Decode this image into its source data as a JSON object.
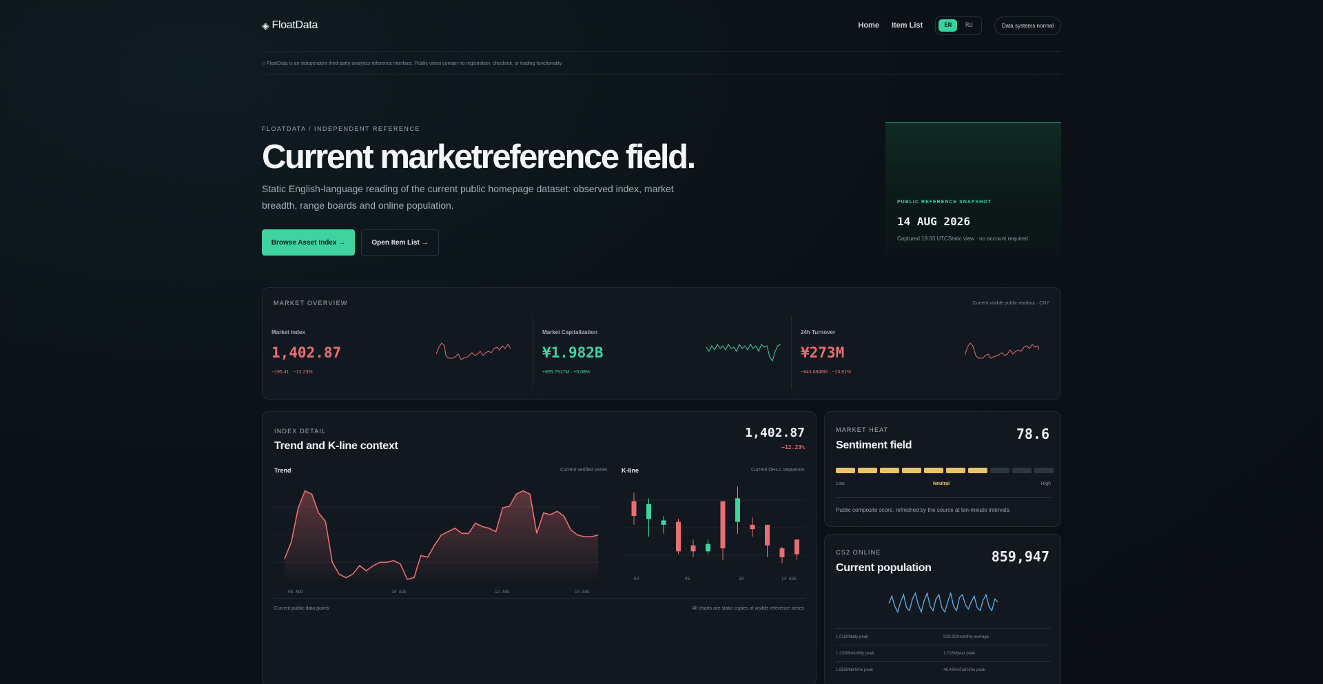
{
  "nav": {
    "brand_icon": "◈",
    "brand": "FloatData",
    "links": [
      "Home",
      "Item List"
    ],
    "lang": [
      "EN",
      "RU"
    ],
    "status": "Data systems normal"
  },
  "disclaimer": "◇ FloatData is an independent third-party analytics reference interface. Public views contain no registration, checkout, or trading functionality.",
  "hero": {
    "eyebrow": "FLOATDATA / INDEPENDENT REFERENCE",
    "title": "Current marketreference field.",
    "subtitle": "Static English-language reading of the current public homepage dataset: observed index, market breadth, range boards and online population.",
    "primary_button": "Browse Asset Index →",
    "secondary_button": "Open Item List →"
  },
  "snapshot": {
    "label": "PUBLIC REFERENCE SNAPSHOT",
    "date": "14 AUG 2026",
    "note": "Captured 19:33 UTCStatic view · no account required"
  },
  "overview": {
    "label": "MARKET OVERVIEW",
    "note": "Current visible public readout · CNY",
    "metrics": [
      {
        "label": "Market Index",
        "value": "1,402.87",
        "change": "−195.41 · −12.23%",
        "color": "#e86f72"
      },
      {
        "label": "Market Capitalization",
        "value": "¥1.982B",
        "change": "+¥95.7917M · +5.08%",
        "color": "#3fd3a0"
      },
      {
        "label": "24h Turnover",
        "value": "¥273M",
        "change": "−¥43.6948M · −13.81%",
        "color": "#e86f72"
      }
    ]
  },
  "index_detail": {
    "kicker": "INDEX DETAIL",
    "title": "Trend and K-line context",
    "value": "1,402.87",
    "change": "−12.23%",
    "trend_label": "Trend",
    "trend_note": "Current verified series",
    "kline_label": "K-line",
    "kline_note": "Current OHLC sequence",
    "footer_left": "Current public data points",
    "footer_right": "All charts are static copies of visible reference series"
  },
  "market_heat": {
    "kicker": "MARKET HEAT",
    "title": "Sentiment field",
    "value": "78.6",
    "segments_total": 10,
    "segments_on": 7,
    "low": "Low",
    "mid": "Neutral",
    "high": "High",
    "note": "Public composite score, refreshed by the source at ten-minute intervals."
  },
  "cs2_online": {
    "kicker": "CS2 ONLINE",
    "title": "Current population",
    "value": "859,947",
    "stats": [
      [
        "1.012Mdaily peak",
        "919,923monthly average"
      ],
      [
        "1.232Mmonthly peak",
        "1.716Myear peak"
      ],
      [
        "1.852Mall-time peak",
        "46.43%of all-time peak"
      ]
    ]
  },
  "chart_data": [
    {
      "type": "line",
      "title": "Trend",
      "x_ticks": [
        "08 AUG",
        "10 AUG",
        "12 AUG",
        "14 AUG"
      ],
      "values": [
        1420,
        1520,
        1720,
        1820,
        1800,
        1690,
        1640,
        1400,
        1330,
        1310,
        1330,
        1380,
        1350,
        1380,
        1400,
        1400,
        1410,
        1390,
        1300,
        1310,
        1440,
        1430,
        1500,
        1560,
        1580,
        1600,
        1570,
        1570,
        1630,
        1610,
        1600,
        1580,
        1720,
        1730,
        1800,
        1820,
        1800,
        1570,
        1690,
        1680,
        1700,
        1670,
        1590,
        1560,
        1550,
        1550,
        1560
      ],
      "color": "#e86f72"
    },
    {
      "type": "candlestick",
      "title": "K-line",
      "x_ticks": [
        "03",
        "06",
        "10",
        "14 AUG"
      ],
      "candles": [
        {
          "o": 1640,
          "h": 1670,
          "l": 1560,
          "c": 1590
        },
        {
          "o": 1580,
          "h": 1650,
          "l": 1520,
          "c": 1630
        },
        {
          "o": 1560,
          "h": 1590,
          "l": 1530,
          "c": 1575
        },
        {
          "o": 1570,
          "h": 1580,
          "l": 1460,
          "c": 1470
        },
        {
          "o": 1490,
          "h": 1510,
          "l": 1450,
          "c": 1470
        },
        {
          "o": 1470,
          "h": 1510,
          "l": 1460,
          "c": 1495
        },
        {
          "o": 1640,
          "h": 1640,
          "l": 1440,
          "c": 1480
        },
        {
          "o": 1570,
          "h": 1690,
          "l": 1530,
          "c": 1650
        },
        {
          "o": 1560,
          "h": 1585,
          "l": 1520,
          "c": 1545
        },
        {
          "o": 1560,
          "h": 1560,
          "l": 1450,
          "c": 1490
        },
        {
          "o": 1480,
          "h": 1485,
          "l": 1430,
          "c": 1450
        },
        {
          "o": 1510,
          "h": 1510,
          "l": 1440,
          "c": 1460
        }
      ],
      "up_color": "#3fd3a0",
      "down_color": "#e86f72"
    },
    {
      "type": "line",
      "title": "Current population",
      "values": [
        0.55,
        0.8,
        0.45,
        0.25,
        0.6,
        0.85,
        0.4,
        0.3,
        0.7,
        0.9,
        0.5,
        0.25,
        0.65,
        0.9,
        0.45,
        0.3,
        0.7,
        0.85,
        0.4,
        0.25,
        0.6,
        0.9,
        0.45,
        0.3,
        0.75,
        0.85,
        0.5,
        0.35,
        0.6,
        0.8,
        0.4,
        0.3,
        0.65,
        0.85,
        0.45,
        0.3,
        0.7,
        0.6
      ],
      "color": "#5fb0e6"
    }
  ]
}
